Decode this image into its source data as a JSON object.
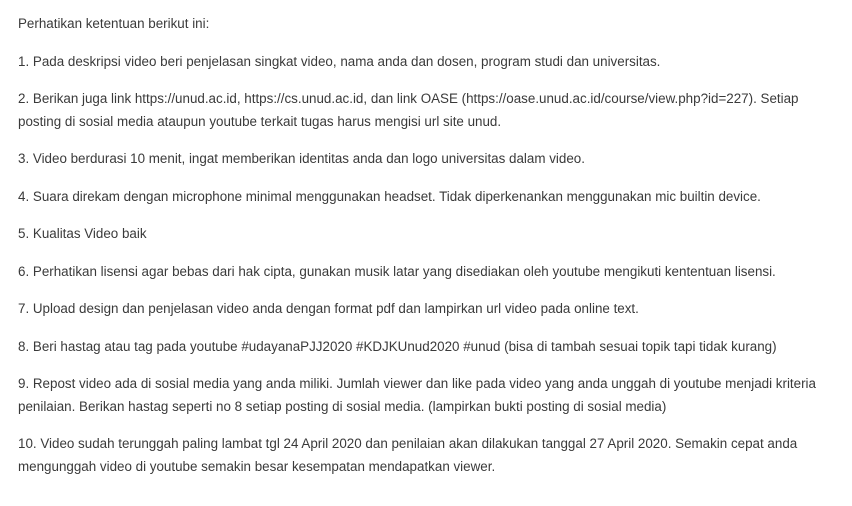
{
  "intro": "Perhatikan ketentuan berikut ini:",
  "rules": [
    "1. Pada deskripsi video beri penjelasan singkat video, nama anda dan dosen, program studi dan universitas.",
    "2. Berikan juga link https://unud.ac.id, https://cs.unud.ac.id, dan link OASE (https://oase.unud.ac.id/course/view.php?id=227). Setiap posting di sosial media ataupun youtube terkait tugas harus mengisi url site unud.",
    "3. Video berdurasi 10 menit, ingat memberikan identitas anda dan logo universitas dalam video.",
    "4. Suara direkam dengan microphone minimal menggunakan headset. Tidak diperkenankan menggunakan mic builtin device.",
    "5. Kualitas Video baik",
    "6. Perhatikan lisensi agar bebas dari hak cipta, gunakan musik latar yang disediakan oleh youtube mengikuti kententuan lisensi.",
    "7. Upload design dan penjelasan video anda dengan format pdf dan lampirkan url video pada online text.",
    "8. Beri hastag atau tag pada youtube #udayanaPJJ2020 #KDJKUnud2020 #unud (bisa di tambah sesuai topik tapi tidak kurang)",
    "9. Repost video ada di sosial media yang anda miliki. Jumlah viewer dan like pada video yang anda unggah di youtube menjadi kriteria penilaian. Berikan hastag seperti no 8 setiap posting di sosial media. (lampirkan bukti posting di sosial media)",
    "10. Video sudah terunggah paling lambat tgl 24 April 2020 dan penilaian akan dilakukan tanggal 27 April 2020. Semakin cepat anda mengunggah video di youtube semakin besar kesempatan mendapatkan viewer."
  ]
}
